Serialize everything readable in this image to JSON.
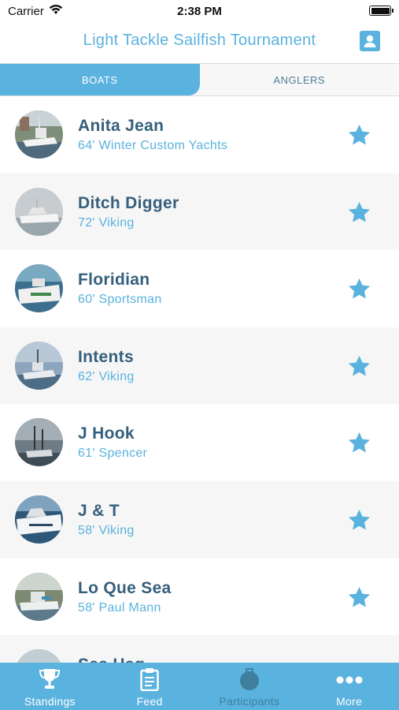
{
  "status_bar": {
    "carrier": "Carrier",
    "time": "2:38 PM"
  },
  "header": {
    "title": "Light Tackle Sailfish Tournament",
    "profile_icon": "person-card-icon"
  },
  "segments": {
    "boats": "BOATS",
    "anglers": "ANGLERS",
    "active": "BOATS"
  },
  "boats": [
    {
      "name": "Anita Jean",
      "desc": "64' Winter Custom Yachts"
    },
    {
      "name": "Ditch Digger",
      "desc": "72' Viking"
    },
    {
      "name": "Floridian",
      "desc": "60' Sportsman"
    },
    {
      "name": "Intents",
      "desc": "62' Viking"
    },
    {
      "name": "J Hook",
      "desc": "61' Spencer"
    },
    {
      "name": "J & T",
      "desc": "58' Viking"
    },
    {
      "name": "Lo Que Sea",
      "desc": "58' Paul Mann"
    },
    {
      "name": "Sea Hag",
      "desc": ""
    }
  ],
  "tabs": {
    "standings": "Standings",
    "feed": "Feed",
    "participants": "Participants",
    "more": "More",
    "selected": "Participants"
  },
  "colors": {
    "accent": "#5ab2de",
    "name_text": "#355f7c",
    "tab_selected": "#3f7f9e"
  }
}
